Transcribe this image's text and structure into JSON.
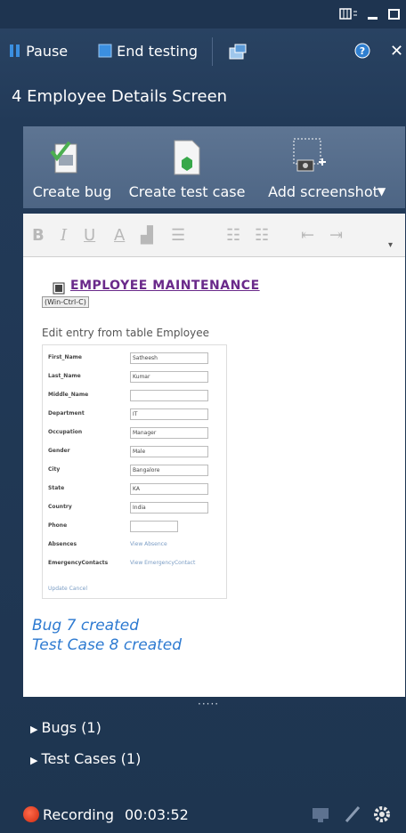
{
  "toolbar": {
    "pause_label": "Pause",
    "end_label": "End testing"
  },
  "header": {
    "title": "4 Employee Details Screen"
  },
  "actions": {
    "create_bug": "Create bug",
    "create_test_case": "Create test case",
    "add_screenshot": "Add screenshot"
  },
  "screenshot": {
    "title": "EMPLOYEE MAINTENANCE",
    "tooltip": "(Win-Ctrl-C)",
    "subtitle": "Edit entry from table Employee",
    "fields": [
      {
        "label": "First_Name",
        "value": "Satheesh"
      },
      {
        "label": "Last_Name",
        "value": "Kumar"
      },
      {
        "label": "Middle_Name",
        "value": ""
      },
      {
        "label": "Department",
        "value": "IT"
      },
      {
        "label": "Occupation",
        "value": "Manager"
      },
      {
        "label": "Gender",
        "value": "Male"
      },
      {
        "label": "City",
        "value": "Bangalore"
      },
      {
        "label": "State",
        "value": "KA"
      },
      {
        "label": "Country",
        "value": "India"
      },
      {
        "label": "Phone",
        "value": ""
      },
      {
        "label": "Absences",
        "value": "View Absence"
      },
      {
        "label": "EmergencyContacts",
        "value": "View EmergencyContact"
      }
    ],
    "update": "Update",
    "cancel": "Cancel"
  },
  "log": {
    "line1": "Bug 7 created",
    "line2": "Test Case 8 created"
  },
  "sections": {
    "bugs": "Bugs (1)",
    "test_cases": "Test Cases (1)"
  },
  "status": {
    "recording_label": "Recording",
    "time": "00:03:52"
  },
  "colors": {
    "accent": "#2d7ad1",
    "panel": "#223a58",
    "band": "#556d8b"
  }
}
